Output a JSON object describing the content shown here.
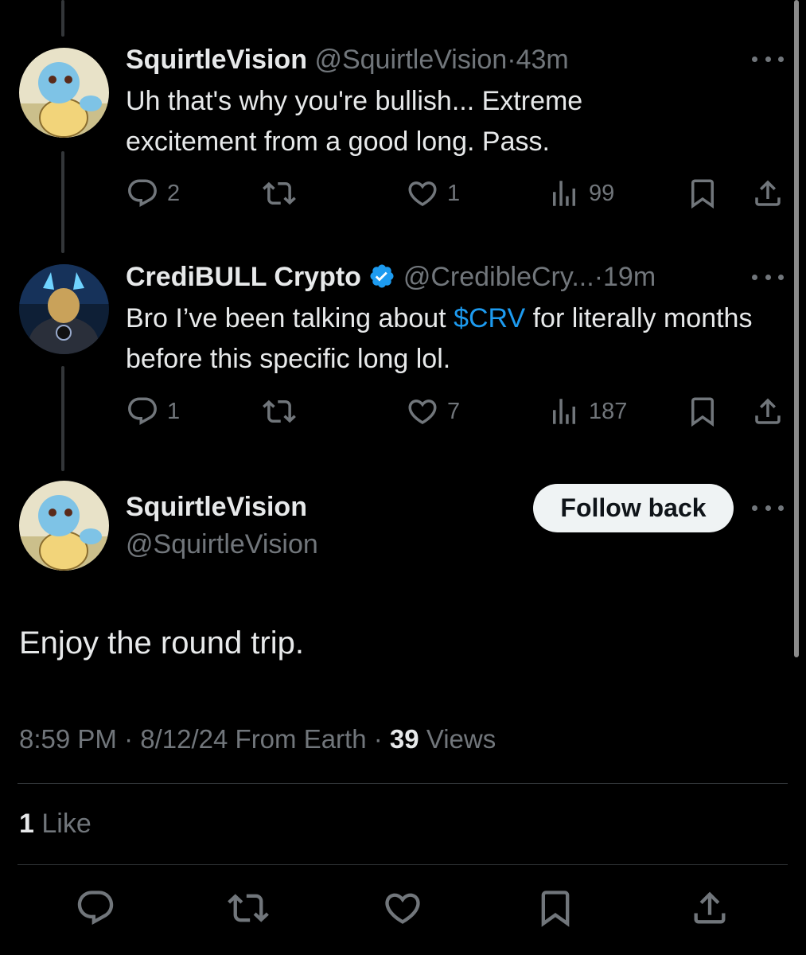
{
  "tweet1": {
    "name": "SquirtleVision",
    "handle": "@SquirtleVision",
    "sep": "·",
    "time": "43m",
    "text": "Uh that's why you're bullish... Extreme excitement from a good long. Pass.",
    "replies": "2",
    "likes": "1",
    "views": "99"
  },
  "tweet2": {
    "name": "CrediBULL Crypto",
    "handle": "@CredibleCry...",
    "sep": "·",
    "time": "19m",
    "text_before": "Bro I’ve been talking about ",
    "cashtag": "$CRV",
    "text_after": " for literally months before this specific long lol.",
    "replies": "1",
    "likes": "7",
    "views": "187"
  },
  "main_tweet": {
    "name": "SquirtleVision",
    "handle": "@SquirtleVision",
    "follow_label": "Follow back",
    "text": "Enjoy the round trip.",
    "time": "8:59 PM",
    "dot": "·",
    "date": "8/12/24",
    "source": "From Earth",
    "views_count": "39",
    "views_label": "Views",
    "likes_count": "1",
    "likes_label": "Like"
  },
  "icons": {
    "reply": "reply-icon",
    "retweet": "retweet-icon",
    "like": "heart-icon",
    "views": "analytics-icon",
    "bookmark": "bookmark-icon",
    "share": "share-icon",
    "more": "more-icon",
    "verified": "verified-badge-icon"
  },
  "colors": {
    "background": "#000000",
    "text": "#e7e9ea",
    "muted": "#71767b",
    "link": "#1d9bf0"
  }
}
